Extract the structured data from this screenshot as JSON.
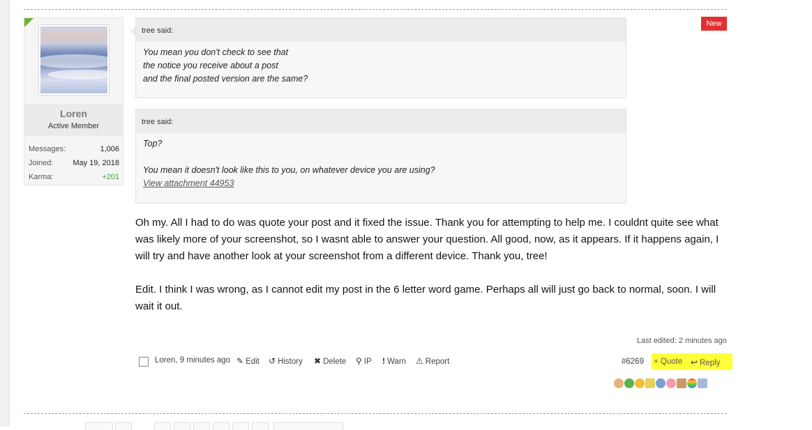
{
  "post": {
    "new_badge": "New",
    "author": {
      "name": "Loren",
      "title": "Active Member",
      "stats": [
        {
          "label": "Messages:",
          "value": "1,006"
        },
        {
          "label": "Joined:",
          "value": "May 19, 2018"
        },
        {
          "label": "Karma:",
          "value": "+201"
        }
      ]
    },
    "quotes": [
      {
        "attribution": "tree said:",
        "lines": [
          "You mean you don't check to see that",
          "the notice you receive about a post",
          "and the final posted version are the same?"
        ]
      },
      {
        "attribution": "tree said:",
        "lines": [
          "Top?",
          "",
          "You mean it doesn't look like this to you, on whatever device you are using?"
        ],
        "attachment": "View attachment 44953"
      }
    ],
    "body": [
      "Oh my. All I had to do was quote your post and it fixed the issue. Thank you for attempting to help me. I couldnt quite see what was likely more of your screenshot, so I wasnt able to answer your question. All good, now, as it appears. If it happens again, I will try and have another look at your screenshot from a different device. Thank you, tree!",
      "Edit. I think I was wrong, as I cannot edit my post in the 6 letter word game. Perhaps all will just go back to normal, soon. I will wait it out."
    ],
    "last_edited": "Last edited: 2 minutes ago",
    "meta": {
      "author_time": "Loren, 9 minutes ago",
      "edit": "Edit",
      "history": "History",
      "delete": "Delete",
      "ip": "IP",
      "warn": "Warn",
      "report": "Report"
    },
    "post_number": "#6269",
    "quote_action": "+ Quote",
    "reply_action": "Reply",
    "highlight_color": "#ffff3a"
  }
}
